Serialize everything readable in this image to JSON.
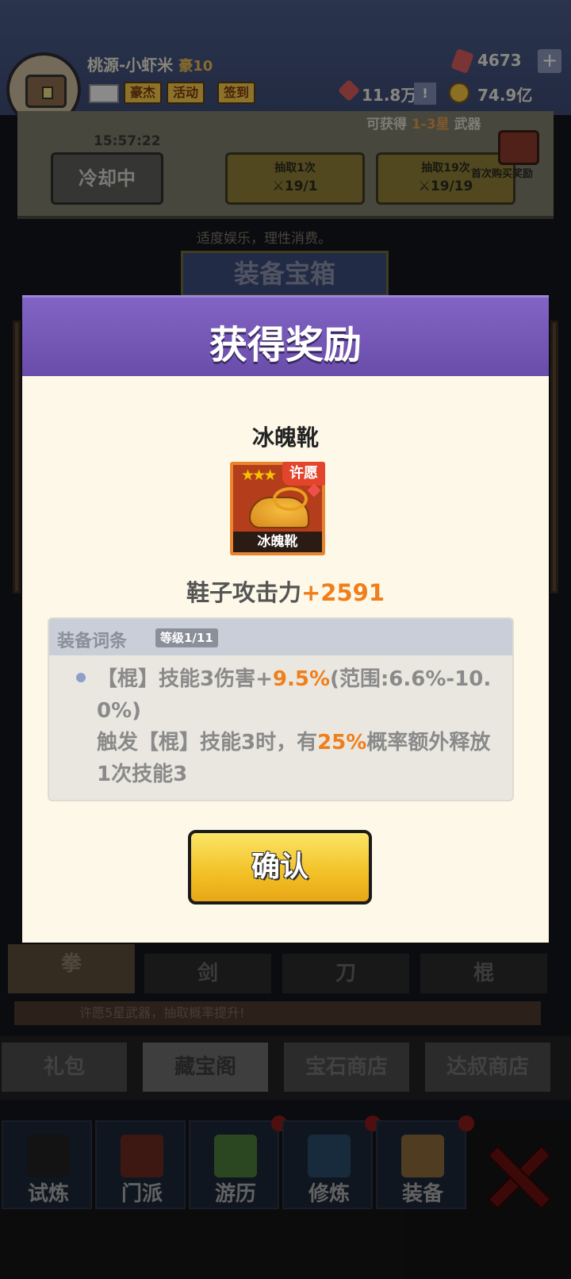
{
  "player": {
    "name": "桃源-小虾米",
    "vip": "豪10",
    "badges": [
      "豪杰",
      "活动",
      "签到"
    ]
  },
  "resources": {
    "gems": "4673",
    "power": "11.8万",
    "coins": "74.9亿"
  },
  "draw_panel": {
    "subtitle_prefix": "可获得",
    "subtitle_range": "1-3星",
    "subtitle_suffix": "武器",
    "timer": "15:57:22",
    "cooldown_label": "冷却中",
    "draw1_label": "抽取1次",
    "draw1_count": "19/1",
    "draw19_label": "抽取19次",
    "draw19_count": "19/19",
    "first_purchase_label": "首次购买奖励"
  },
  "hint": "适度娱乐，理性消费。",
  "section_title": "装备宝箱",
  "weapon_tabs": [
    "拳",
    "剑",
    "刀",
    "棍"
  ],
  "weapon_note": "许愿5星武器，抽取概率提升!",
  "shop_tabs": [
    "礼包",
    "藏宝阁",
    "宝石商店",
    "达叔商店"
  ],
  "bottom_nav": [
    "试炼",
    "门派",
    "游历",
    "修炼",
    "装备"
  ],
  "modal": {
    "title": "获得奖励",
    "item_name": "冰魄靴",
    "item_card_label": "冰魄靴",
    "wish_badge": "许愿",
    "stars": "★★★",
    "stat_label": "鞋子攻击力",
    "stat_value": "+2591",
    "affix_title": "装备词条",
    "affix_level": "等级1/11",
    "affix_line1_a": "【棍】技能3伤害+",
    "affix_line1_hl": "9.5%",
    "affix_line1_b": "(范围:6.6%-10.0%)",
    "affix_line2_a": "触发【棍】技能3时，有",
    "affix_line2_hl": "25%",
    "affix_line2_b": "概率额外释放1次技能3",
    "confirm_label": "确认"
  }
}
